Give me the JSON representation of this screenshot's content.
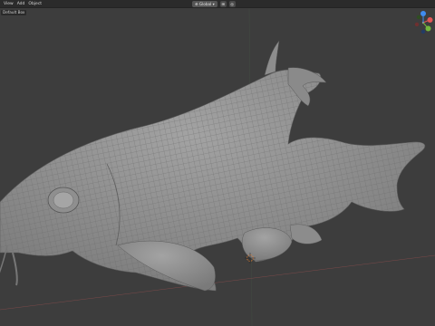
{
  "menu": {
    "items": [
      "View",
      "Add",
      "Object"
    ]
  },
  "header": {
    "orientation": "Global",
    "snap_icon": "snap-icon",
    "proportional_icon": "proportional-edit-icon"
  },
  "mode": {
    "label": "Default Box"
  },
  "gizmo": {
    "axes": [
      "X",
      "Y",
      "Z"
    ],
    "colors": {
      "x": "#e35656",
      "y": "#74b83d",
      "z": "#3f8cf0"
    }
  },
  "viewport": {
    "background": "#3d3d3d",
    "mesh_color": "#8f8f8f",
    "wire_color": "#6d6d6d"
  }
}
